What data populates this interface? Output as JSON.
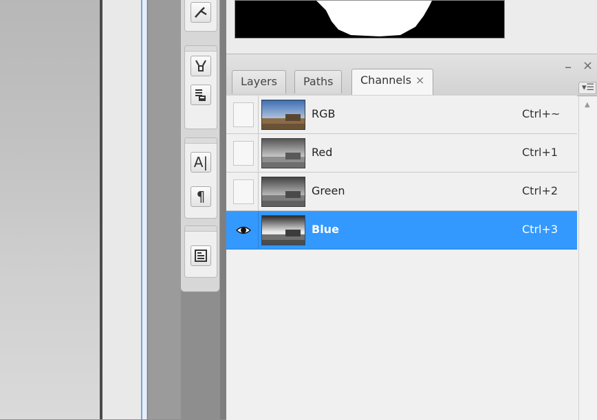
{
  "panel": {
    "tabs": [
      {
        "label": "Layers",
        "active": false
      },
      {
        "label": "Paths",
        "active": false
      },
      {
        "label": "Channels",
        "active": true
      }
    ],
    "tab_close_glyph": "×",
    "collapse_glyph": "–",
    "close_glyph": "×",
    "menu_glyph": "▾☰"
  },
  "channels": [
    {
      "name": "RGB",
      "shortcut": "Ctrl+~",
      "visible": false,
      "selected": false,
      "thumb": "color"
    },
    {
      "name": "Red",
      "shortcut": "Ctrl+1",
      "visible": false,
      "selected": false,
      "thumb": "gray-light"
    },
    {
      "name": "Green",
      "shortcut": "Ctrl+2",
      "visible": false,
      "selected": false,
      "thumb": "gray-mid"
    },
    {
      "name": "Blue",
      "shortcut": "Ctrl+3",
      "visible": true,
      "selected": true,
      "thumb": "gray-dark"
    }
  ],
  "tools": [
    {
      "icon": "brush-scissors-icon"
    },
    {
      "icon": "clone-source-icon"
    },
    {
      "icon": "tool-presets-icon"
    },
    {
      "icon": "character-icon",
      "glyph": "A|"
    },
    {
      "icon": "paragraph-icon",
      "glyph": "¶"
    },
    {
      "icon": "notes-icon"
    }
  ],
  "colors": {
    "selection": "#3399ff",
    "panel_bg": "#f0f0f0"
  }
}
